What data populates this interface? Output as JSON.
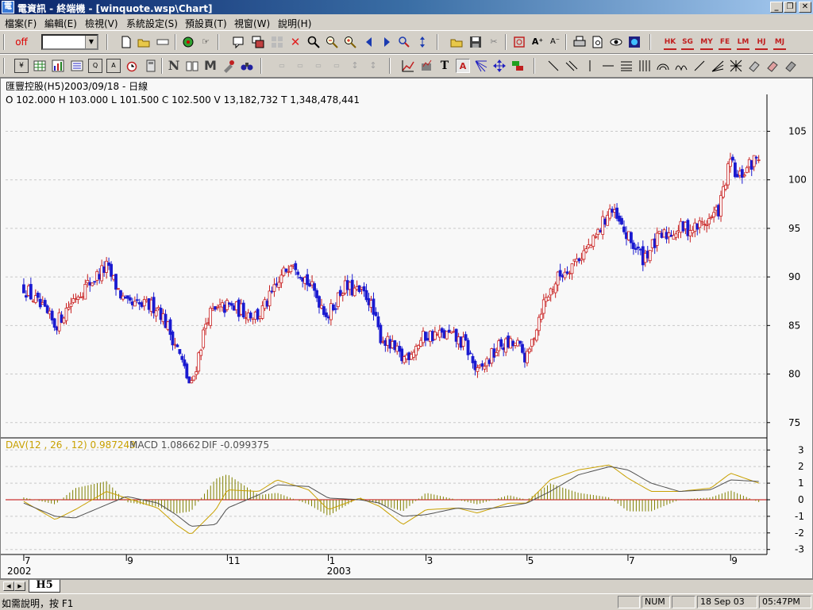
{
  "window": {
    "title": "電資訊 - 終端機 - [winquote.wsp\\Chart]",
    "controls": [
      "_",
      "❐",
      "✕"
    ]
  },
  "menu": [
    "檔案(F)",
    "編輯(E)",
    "檢視(V)",
    "系統設定(S)",
    "預設頁(T)",
    "視窗(W)",
    "說明(H)"
  ],
  "toolbar1": {
    "off_label": "off",
    "combo_value": "",
    "market_labels": [
      "HK",
      "SG",
      "MY",
      "FE",
      "LM",
      "HJ",
      "MJ"
    ],
    "market_colors": [
      "#c02020",
      "#c02020",
      "#c02020",
      "#c02020",
      "#c02020",
      "#c02020",
      "#c02020"
    ]
  },
  "chart": {
    "header": "匯豐控股(H5)2003/09/18  - 日線",
    "ohlc_line": "O 102.000 H 103.000 L 101.500 C 102.500 V 13,182,732 T 1,348,478,441",
    "macd_line": {
      "dav": "DAV(12 , 26 , 12)  0.987243",
      "macd": "MACD  1.08662",
      "dif": "DIF  -0.099375"
    },
    "x_month_labels": [
      "7",
      "9",
      "11",
      "1",
      "3",
      "5",
      "7",
      "9"
    ],
    "x_year_labels": [
      "2002",
      "2003"
    ],
    "colors": {
      "up": "#c82020",
      "down": "#1a1ad0",
      "dav": "#c8a000",
      "macd": "#505050",
      "zero": "#c00000",
      "hist": "#808000"
    }
  },
  "chart_data": [
    {
      "type": "candlestick",
      "title": "匯豐控股(H5)2003/09/18 - 日線",
      "y_ticks": [
        75,
        80,
        85,
        90,
        95,
        100,
        105
      ],
      "ylim": [
        74,
        107
      ],
      "x_months": [
        "2002-07",
        "2002-09",
        "2002-11",
        "2003-01",
        "2003-03",
        "2003-05",
        "2003-07",
        "2003-09"
      ],
      "approx_close_trend": [
        {
          "x": "2002-07",
          "y": 89
        },
        {
          "x": "2002-07-20",
          "y": 85
        },
        {
          "x": "2002-08",
          "y": 88
        },
        {
          "x": "2002-08-20",
          "y": 91
        },
        {
          "x": "2002-09",
          "y": 87
        },
        {
          "x": "2002-09-20",
          "y": 87
        },
        {
          "x": "2002-10",
          "y": 83
        },
        {
          "x": "2002-10-10",
          "y": 78.5
        },
        {
          "x": "2002-10-20",
          "y": 86
        },
        {
          "x": "2002-11",
          "y": 87
        },
        {
          "x": "2002-11-20",
          "y": 86
        },
        {
          "x": "2002-12",
          "y": 89
        },
        {
          "x": "2002-12-10",
          "y": 92
        },
        {
          "x": "2002-12-25",
          "y": 88
        },
        {
          "x": "2003-01",
          "y": 86
        },
        {
          "x": "2003-01-10",
          "y": 89
        },
        {
          "x": "2003-01-25",
          "y": 88
        },
        {
          "x": "2003-02",
          "y": 84
        },
        {
          "x": "2003-02-15",
          "y": 81.5
        },
        {
          "x": "2003-03",
          "y": 84
        },
        {
          "x": "2003-03-15",
          "y": 84
        },
        {
          "x": "2003-03-25",
          "y": 83
        },
        {
          "x": "2003-04",
          "y": 80
        },
        {
          "x": "2003-04-15",
          "y": 83
        },
        {
          "x": "2003-04-25",
          "y": 83
        },
        {
          "x": "2003-05",
          "y": 81.5
        },
        {
          "x": "2003-05-10",
          "y": 87
        },
        {
          "x": "2003-05-20",
          "y": 90
        },
        {
          "x": "2003-06",
          "y": 92
        },
        {
          "x": "2003-06-10",
          "y": 93.5
        },
        {
          "x": "2003-06-20",
          "y": 97
        },
        {
          "x": "2003-07",
          "y": 94
        },
        {
          "x": "2003-07-10",
          "y": 92
        },
        {
          "x": "2003-07-20",
          "y": 94
        },
        {
          "x": "2003-08",
          "y": 95
        },
        {
          "x": "2003-08-10",
          "y": 95
        },
        {
          "x": "2003-08-20",
          "y": 96
        },
        {
          "x": "2003-08-25",
          "y": 97
        },
        {
          "x": "2003-09",
          "y": 102
        },
        {
          "x": "2003-09-05",
          "y": 100
        },
        {
          "x": "2003-09-10",
          "y": 101
        },
        {
          "x": "2003-09-18",
          "y": 102.5
        }
      ]
    },
    {
      "type": "line",
      "title": "DAV(12 , 26 , 12)",
      "y_ticks": [
        -3,
        -2,
        -1,
        0,
        1,
        2,
        3
      ],
      "ylim": [
        -3.3,
        3.3
      ],
      "series": [
        {
          "name": "DAV",
          "values": [
            {
              "x": "2002-07",
              "y": -0.1
            },
            {
              "x": "2002-07-20",
              "y": -1.2
            },
            {
              "x": "2002-08",
              "y": -0.6
            },
            {
              "x": "2002-08-20",
              "y": 0.5
            },
            {
              "x": "2002-09",
              "y": 0.1
            },
            {
              "x": "2002-09-20",
              "y": -0.5
            },
            {
              "x": "2002-10",
              "y": -1.5
            },
            {
              "x": "2002-10-10",
              "y": -2.1
            },
            {
              "x": "2002-10-25",
              "y": -0.6
            },
            {
              "x": "2002-11",
              "y": 0.6
            },
            {
              "x": "2002-11-20",
              "y": 0.5
            },
            {
              "x": "2002-12",
              "y": 1.2
            },
            {
              "x": "2002-12-20",
              "y": 0.6
            },
            {
              "x": "2003-01",
              "y": -0.6
            },
            {
              "x": "2003-01-20",
              "y": 0.1
            },
            {
              "x": "2003-02",
              "y": -0.4
            },
            {
              "x": "2003-02-15",
              "y": -1.5
            },
            {
              "x": "2003-03",
              "y": -0.6
            },
            {
              "x": "2003-03-20",
              "y": -0.5
            },
            {
              "x": "2003-04",
              "y": -0.8
            },
            {
              "x": "2003-04-20",
              "y": -0.2
            },
            {
              "x": "2003-05",
              "y": -0.2
            },
            {
              "x": "2003-05-15",
              "y": 1.2
            },
            {
              "x": "2003-06",
              "y": 1.8
            },
            {
              "x": "2003-06-20",
              "y": 2.1
            },
            {
              "x": "2003-07",
              "y": 1.3
            },
            {
              "x": "2003-07-15",
              "y": 0.5
            },
            {
              "x": "2003-08",
              "y": 0.5
            },
            {
              "x": "2003-08-20",
              "y": 0.7
            },
            {
              "x": "2003-09",
              "y": 1.6
            },
            {
              "x": "2003-09-18",
              "y": 1.0
            }
          ]
        },
        {
          "name": "MACD",
          "values": [
            {
              "x": "2002-07",
              "y": -0.2
            },
            {
              "x": "2002-07-20",
              "y": -1.0
            },
            {
              "x": "2002-08",
              "y": -1.1
            },
            {
              "x": "2002-08-20",
              "y": -0.3
            },
            {
              "x": "2002-09",
              "y": 0.2
            },
            {
              "x": "2002-09-20",
              "y": -0.2
            },
            {
              "x": "2002-10",
              "y": -0.9
            },
            {
              "x": "2002-10-10",
              "y": -1.6
            },
            {
              "x": "2002-10-25",
              "y": -1.5
            },
            {
              "x": "2002-11",
              "y": -0.5
            },
            {
              "x": "2002-11-20",
              "y": 0.3
            },
            {
              "x": "2002-12",
              "y": 0.9
            },
            {
              "x": "2002-12-20",
              "y": 0.8
            },
            {
              "x": "2003-01",
              "y": 0.1
            },
            {
              "x": "2003-01-20",
              "y": 0.0
            },
            {
              "x": "2003-02",
              "y": -0.2
            },
            {
              "x": "2003-02-15",
              "y": -1.0
            },
            {
              "x": "2003-03",
              "y": -0.9
            },
            {
              "x": "2003-03-20",
              "y": -0.5
            },
            {
              "x": "2003-04",
              "y": -0.6
            },
            {
              "x": "2003-04-20",
              "y": -0.4
            },
            {
              "x": "2003-05",
              "y": -0.2
            },
            {
              "x": "2003-05-15",
              "y": 0.5
            },
            {
              "x": "2003-06",
              "y": 1.5
            },
            {
              "x": "2003-06-20",
              "y": 2.0
            },
            {
              "x": "2003-07",
              "y": 1.8
            },
            {
              "x": "2003-07-15",
              "y": 1.0
            },
            {
              "x": "2003-08",
              "y": 0.5
            },
            {
              "x": "2003-08-20",
              "y": 0.6
            },
            {
              "x": "2003-09",
              "y": 1.2
            },
            {
              "x": "2003-09-18",
              "y": 1.1
            }
          ]
        }
      ]
    }
  ],
  "sheet_tab": "H5",
  "status": {
    "help": "如需說明，按 F1",
    "num": "NUM",
    "date": "18 Sep 03",
    "time": "05:47PM"
  }
}
